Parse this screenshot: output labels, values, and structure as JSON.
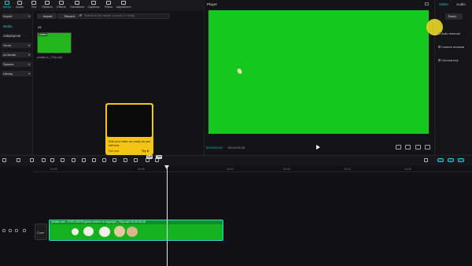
{
  "top_toolbar": {
    "tools": [
      {
        "label": "Media",
        "icon": "media-icon",
        "active": true
      },
      {
        "label": "Audio",
        "icon": "audio-icon"
      },
      {
        "label": "Text",
        "icon": "text-icon"
      },
      {
        "label": "Stickers",
        "icon": "stickers-icon"
      },
      {
        "label": "Effects",
        "icon": "effects-icon"
      },
      {
        "label": "Transitions",
        "icon": "transitions-icon"
      },
      {
        "label": "Captions",
        "icon": "captions-icon"
      },
      {
        "label": "Filters",
        "icon": "filters-icon"
      },
      {
        "label": "Adjustment",
        "icon": "adjustment-icon"
      }
    ]
  },
  "sidebar": {
    "import_select": "Import",
    "items": [
      "Media",
      "Subprojects"
    ],
    "selects": [
      "Yours",
      "AI media",
      "Spaces",
      "Library"
    ]
  },
  "media_panel": {
    "import_button": "Import",
    "record_button": "Record",
    "search_placeholder": "Search for file names, sources, or things",
    "filter_label": "All",
    "thumb_badge": "Added",
    "thumb_label": "ytmate.cc_720p.mp4"
  },
  "tooltip": {
    "text": "Edit your video as easily as you edit text.",
    "later": "Not now",
    "try": "Try it"
  },
  "player": {
    "title": "Player",
    "timecode_current": "00:00:04:07",
    "timecode_total": "00:00:05:28"
  },
  "right_panel": {
    "tabs": [
      "Video",
      "Audio"
    ],
    "ratio_label": "Basic",
    "options": [
      "Auto removal",
      "Custom removal",
      "Chroma key"
    ]
  },
  "timeline": {
    "ticks": [
      "00:00",
      "00:05",
      "00:10",
      "00:15",
      "00:20",
      "00:25"
    ],
    "toolbar_tips": [
      "Split",
      "Trim"
    ],
    "cover_label": "Cover",
    "clip_name": "ytmate.com - EXPLOSION green screen no copyright_720p.mp4   00:00:05:28"
  },
  "colors": {
    "accent": "#22c4d6",
    "chroma_green": "#14c81e",
    "tooltip_yellow": "#f5c515",
    "cursor_highlight": "#ebd628"
  }
}
